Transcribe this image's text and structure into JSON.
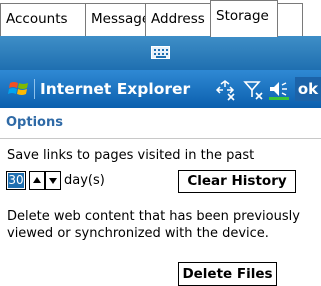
{
  "tabs": [
    {
      "label": "Accounts"
    },
    {
      "label": "Message"
    },
    {
      "label": "Address"
    },
    {
      "label": "Storage",
      "active": true
    }
  ],
  "sip": {
    "icon": "keyboard-icon"
  },
  "titlebar": {
    "title": "Internet Explorer",
    "start_icon": "windows-flag-icon",
    "status_icons": [
      "connectivity-icon",
      "signal-icon",
      "volume-icon"
    ],
    "ok_label": "ok"
  },
  "options": {
    "title": "Options"
  },
  "history": {
    "save_label": "Save links to pages visited in the past",
    "days_value": "30",
    "days_unit": "day(s)",
    "clear_button": "Clear History"
  },
  "web_content": {
    "description_line1": "Delete web content that has been previously",
    "description_line2": "viewed or synchronized with the device.",
    "delete_button": "Delete Files"
  },
  "colors": {
    "accent": "#1f6fb0",
    "title_bar": "#0b5fae",
    "options_text": "#2f6aa6"
  }
}
